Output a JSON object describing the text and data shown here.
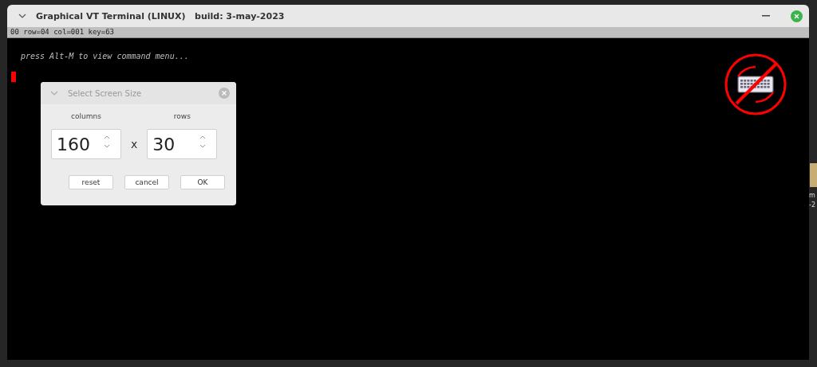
{
  "window": {
    "title": "Graphical VT Terminal (LINUX)   build: 3-may-2023"
  },
  "status_line": "00 row=04 col=001 key=63",
  "terminal": {
    "prompt": "press Alt-M to view command menu...",
    "cursor": true,
    "keyboard_disabled": true
  },
  "dialog": {
    "title": "Select Screen Size",
    "fields": [
      {
        "label": "columns",
        "value": "160"
      },
      {
        "label": "rows",
        "value": "30"
      }
    ],
    "separator": "x",
    "buttons": [
      "reset",
      "cancel",
      "OK"
    ]
  },
  "desktop": {
    "icon_label_lines": [
      "m",
      "-2"
    ]
  }
}
